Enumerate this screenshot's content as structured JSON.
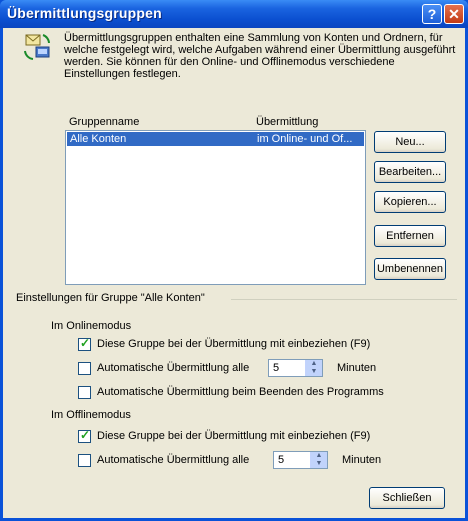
{
  "window": {
    "title": "Übermittlungsgruppen",
    "help_glyph": "?",
    "close_glyph": "✕"
  },
  "intro_text": "Übermittlungsgruppen enthalten eine Sammlung von Konten und Ordnern, für welche festgelegt wird, welche Aufgaben während einer Übermittlung ausgeführt werden. Sie können für den Online- und Offlinemodus verschiedene Einstellungen festlegen.",
  "list": {
    "columns": [
      "Gruppenname",
      "Übermittlung"
    ],
    "rows": [
      {
        "name": "Alle Konten",
        "sync": "im Online- und Of..."
      }
    ]
  },
  "buttons": {
    "new": "Neu...",
    "edit": "Bearbeiten...",
    "copy": "Kopieren...",
    "remove": "Entfernen",
    "rename": "Umbenennen",
    "close": "Schließen"
  },
  "settings": {
    "group_title": "Einstellungen für Gruppe \"Alle Konten\"",
    "online": {
      "heading": "Im Onlinemodus",
      "include_label": "Diese Gruppe bei der Übermittlung mit einbeziehen (F9)",
      "include_checked": true,
      "auto_label": "Automatische Übermittlung alle",
      "auto_checked": false,
      "auto_value": "5",
      "minutes": "Minuten",
      "on_exit_label": "Automatische Übermittlung beim Beenden des Programms",
      "on_exit_checked": false
    },
    "offline": {
      "heading": "Im Offlinemodus",
      "include_label": "Diese Gruppe bei der Übermittlung mit einbeziehen (F9)",
      "include_checked": true,
      "auto_label": "Automatische Übermittlung alle",
      "auto_checked": false,
      "auto_value": "5",
      "minutes": "Minuten"
    }
  }
}
